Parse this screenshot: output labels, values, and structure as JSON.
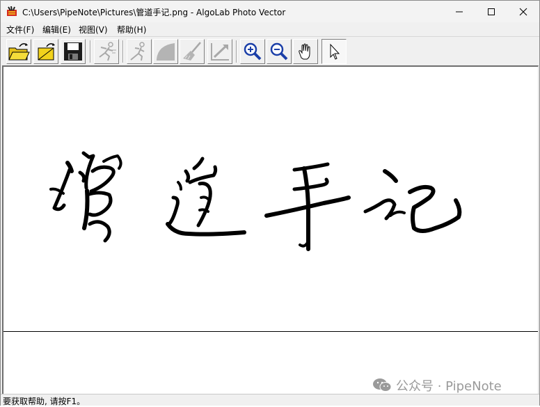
{
  "window": {
    "title": "C:\\Users\\PipeNote\\Pictures\\管道手记.png - AlgoLab Photo Vector"
  },
  "menu": [
    {
      "label": "文件(F)"
    },
    {
      "label": "编辑(E)"
    },
    {
      "label": "视图(V)"
    },
    {
      "label": "帮助(H)"
    }
  ],
  "toolbar": {
    "buttons": [
      {
        "icon": "open-folder-icon",
        "enabled": true
      },
      {
        "icon": "open-image-icon",
        "enabled": true
      },
      {
        "icon": "save-disk-icon",
        "enabled": true
      },
      {
        "icon": "vectorize-icon",
        "enabled": false
      },
      {
        "icon": "vectorize-step-icon",
        "enabled": false
      },
      {
        "icon": "shape-icon",
        "enabled": false
      },
      {
        "icon": "clean-brush-icon",
        "enabled": false
      },
      {
        "icon": "resize-icon",
        "enabled": false
      },
      {
        "icon": "zoom-in-icon",
        "enabled": true
      },
      {
        "icon": "zoom-out-icon",
        "enabled": true
      },
      {
        "icon": "hand-pan-icon",
        "enabled": true
      },
      {
        "icon": "pointer-icon",
        "enabled": true,
        "selected": true
      }
    ]
  },
  "canvas": {
    "image_text": "管道手记"
  },
  "status": {
    "text": "要获取帮助, 请按F1。"
  },
  "watermark": {
    "text": "公众号 · PipeNote"
  },
  "colors": {
    "window_bg": "#f0f0f0",
    "canvas_bg": "#ffffff",
    "ink": "#000000",
    "icon_yellow": "#f2d21c",
    "icon_blue": "#1b3fa8",
    "icon_disabled": "#a8a8a8"
  }
}
